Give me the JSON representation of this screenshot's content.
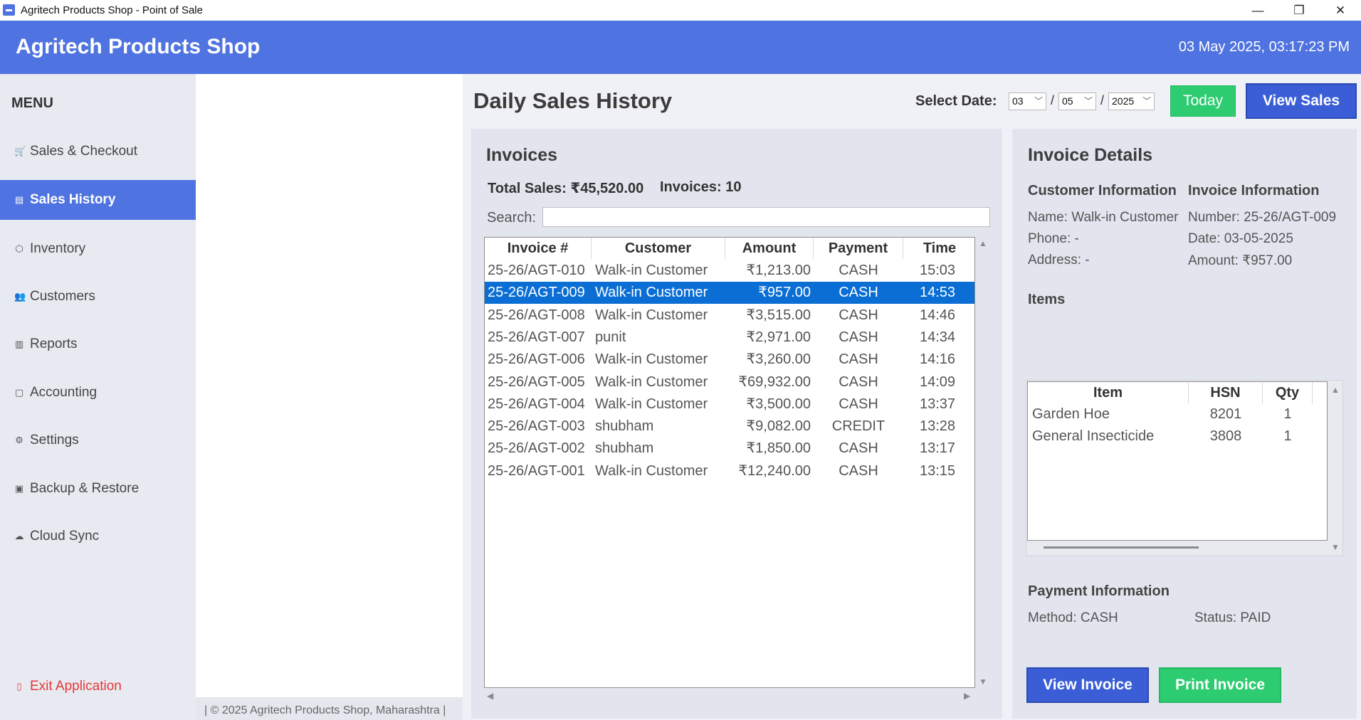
{
  "window": {
    "title": "Agritech Products Shop - Point of Sale",
    "controls": {
      "minimize": "—",
      "maximize": "❐",
      "close": "✕"
    }
  },
  "header": {
    "shop_name": "Agritech Products Shop",
    "datetime": "03 May 2025, 03:17:23 PM"
  },
  "sidebar": {
    "menu_label": "MENU",
    "items": [
      {
        "label": "Sales & Checkout",
        "icon": "cart-icon",
        "active": false
      },
      {
        "label": "Sales History",
        "icon": "receipt-icon",
        "active": true
      },
      {
        "label": "Inventory",
        "icon": "package-icon",
        "active": false
      },
      {
        "label": "Customers",
        "icon": "users-icon",
        "active": false
      },
      {
        "label": "Reports",
        "icon": "chart-icon",
        "active": false
      },
      {
        "label": "Accounting",
        "icon": "ledger-icon",
        "active": false
      },
      {
        "label": "Settings",
        "icon": "gear-icon",
        "active": false
      },
      {
        "label": "Backup & Restore",
        "icon": "floppy-icon",
        "active": false
      },
      {
        "label": "Cloud Sync",
        "icon": "cloud-icon",
        "active": false
      }
    ],
    "exit_label": "Exit Application"
  },
  "footer": {
    "text": "| © 2025 Agritech Products Shop, Maharashtra |"
  },
  "page": {
    "title": "Daily Sales History",
    "select_date_label": "Select Date:",
    "date": {
      "day": "03",
      "month": "05",
      "year": "2025"
    },
    "today_label": "Today",
    "view_sales_label": "View Sales"
  },
  "invoices": {
    "title": "Invoices",
    "total_sales": "Total Sales: ₹45,520.00",
    "count": "Invoices: 10",
    "search_label": "Search:",
    "search_value": "",
    "columns": [
      "Invoice #",
      "Customer",
      "Amount",
      "Payment",
      "Time"
    ],
    "rows": [
      {
        "invoice": "25-26/AGT-010",
        "customer": "Walk-in Customer",
        "amount": "₹1,213.00",
        "payment": "CASH",
        "time": "15:03",
        "selected": false
      },
      {
        "invoice": "25-26/AGT-009",
        "customer": "Walk-in Customer",
        "amount": "₹957.00",
        "payment": "CASH",
        "time": "14:53",
        "selected": true
      },
      {
        "invoice": "25-26/AGT-008",
        "customer": "Walk-in Customer",
        "amount": "₹3,515.00",
        "payment": "CASH",
        "time": "14:46",
        "selected": false
      },
      {
        "invoice": "25-26/AGT-007",
        "customer": "punit",
        "amount": "₹2,971.00",
        "payment": "CASH",
        "time": "14:34",
        "selected": false
      },
      {
        "invoice": "25-26/AGT-006",
        "customer": "Walk-in Customer",
        "amount": "₹3,260.00",
        "payment": "CASH",
        "time": "14:16",
        "selected": false
      },
      {
        "invoice": "25-26/AGT-005",
        "customer": "Walk-in Customer",
        "amount": "₹69,932.00",
        "payment": "CASH",
        "time": "14:09",
        "selected": false
      },
      {
        "invoice": "25-26/AGT-004",
        "customer": "Walk-in Customer",
        "amount": "₹3,500.00",
        "payment": "CASH",
        "time": "13:37",
        "selected": false
      },
      {
        "invoice": "25-26/AGT-003",
        "customer": "shubham",
        "amount": "₹9,082.00",
        "payment": "CREDIT",
        "time": "13:28",
        "selected": false
      },
      {
        "invoice": "25-26/AGT-002",
        "customer": "shubham",
        "amount": "₹1,850.00",
        "payment": "CASH",
        "time": "13:17",
        "selected": false
      },
      {
        "invoice": "25-26/AGT-001",
        "customer": "Walk-in Customer",
        "amount": "₹12,240.00",
        "payment": "CASH",
        "time": "13:15",
        "selected": false
      }
    ]
  },
  "details": {
    "title": "Invoice Details",
    "customer_heading": "Customer Information",
    "customer_name": "Name: Walk-in Customer",
    "customer_phone": "Phone: -",
    "customer_address": "Address: -",
    "invoice_heading": "Invoice Information",
    "invoice_number": "Number: 25-26/AGT-009",
    "invoice_date": "Date: 03-05-2025",
    "invoice_amount": "Amount: ₹957.00",
    "items_heading": "Items",
    "item_columns": [
      "Item",
      "HSN",
      "Qty"
    ],
    "items": [
      {
        "name": "Garden Hoe",
        "hsn": "8201",
        "qty": "1"
      },
      {
        "name": "General Insecticide",
        "hsn": "3808",
        "qty": "1"
      }
    ],
    "payment_heading": "Payment Information",
    "payment_method": "Method: CASH",
    "payment_status": "Status: PAID",
    "view_invoice_label": "View Invoice",
    "print_invoice_label": "Print Invoice"
  },
  "colors": {
    "primary": "#4f73e0",
    "success": "#2ecc71",
    "selected_row": "#0a6ed4",
    "danger": "#e53935"
  }
}
